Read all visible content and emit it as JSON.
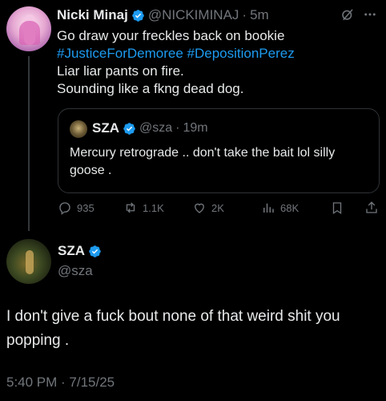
{
  "tweet": {
    "author_name": "Nicki Minaj",
    "handle": "@NICKIMINAJ",
    "time": "5m",
    "lines": [
      "Go draw your freckles back on bookie",
      "",
      "Liar liar pants on fire.",
      "Sounding like a fkng dead dog."
    ],
    "hashtags": [
      "#JusticeForDemoree",
      "#DepositionPerez"
    ],
    "quote": {
      "author_name": "SZA",
      "handle": "@sza",
      "time": "19m",
      "text": "Mercury retrograde .. don't take the bait lol silly goose ."
    },
    "actions": {
      "replies": "935",
      "retweets": "1.1K",
      "likes": "2K",
      "views": "68K"
    }
  },
  "reply": {
    "author_name": "SZA",
    "handle": "@sza",
    "text": "I don't give a fuck bout none of that weird shit you popping .",
    "timestamp": "5:40 PM · 7/15/25"
  },
  "colors": {
    "background": "#000000",
    "text": "#e7e9ea",
    "muted": "#71767b",
    "link": "#1d9bf0",
    "verified": "#1d9bf0"
  },
  "icons": [
    "verified-badge-icon",
    "grok-icon",
    "more-icon",
    "reply-icon",
    "retweet-icon",
    "like-icon",
    "views-icon",
    "bookmark-icon",
    "share-icon"
  ]
}
